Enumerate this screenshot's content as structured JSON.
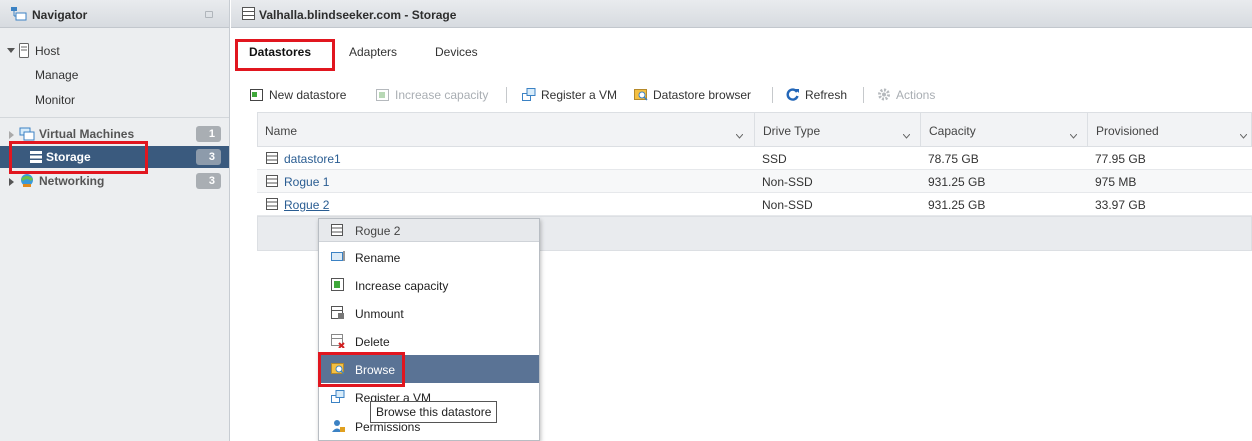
{
  "navigator": {
    "title": "Navigator",
    "host": {
      "label": "Host",
      "children": [
        "Manage",
        "Monitor"
      ]
    },
    "items": [
      {
        "label": "Virtual Machines",
        "count": "1"
      },
      {
        "label": "Storage",
        "count": "3"
      },
      {
        "label": "Networking",
        "count": "3"
      }
    ]
  },
  "window": {
    "title": "Valhalla.blindseeker.com - Storage"
  },
  "tabs": [
    "Datastores",
    "Adapters",
    "Devices"
  ],
  "toolbar": {
    "new_datastore": "New datastore",
    "increase_capacity": "Increase capacity",
    "register_vm": "Register a VM",
    "datastore_browser": "Datastore browser",
    "refresh": "Refresh",
    "actions": "Actions"
  },
  "grid": {
    "columns": [
      "Name",
      "Drive Type",
      "Capacity",
      "Provisioned"
    ],
    "rows": [
      {
        "name": "datastore1",
        "drive_type": "SSD",
        "capacity": "78.75 GB",
        "provisioned": "77.95 GB"
      },
      {
        "name": "Rogue 1",
        "drive_type": "Non-SSD",
        "capacity": "931.25 GB",
        "provisioned": "975 MB"
      },
      {
        "name": "Rogue 2",
        "drive_type": "Non-SSD",
        "capacity": "931.25 GB",
        "provisioned": "33.97 GB"
      }
    ]
  },
  "context_menu": {
    "title": "Rogue 2",
    "items": [
      "Rename",
      "Increase capacity",
      "Unmount",
      "Delete",
      "Browse",
      "Register a VM",
      "Permissions"
    ],
    "active_item": "Browse"
  },
  "tooltip": "Browse this datastore",
  "colors": {
    "selected_nav": "#3a5a7e",
    "active_menu": "#5a7395",
    "highlight_box": "#e1161f",
    "link": "#2a5d92"
  }
}
